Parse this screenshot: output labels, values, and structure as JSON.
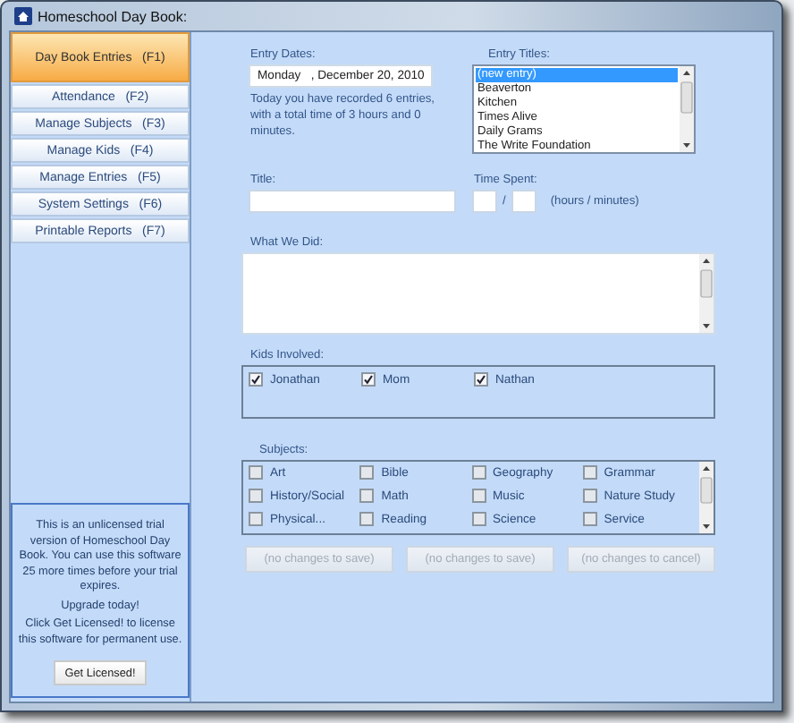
{
  "window": {
    "title": "Homeschool Day Book:"
  },
  "sidebar": {
    "items": [
      {
        "label": "Day Book Entries   (F1)",
        "selected": true
      },
      {
        "label": "Attendance   (F2)",
        "selected": false
      },
      {
        "label": "Manage Subjects   (F3)",
        "selected": false
      },
      {
        "label": "Manage Kids   (F4)",
        "selected": false
      },
      {
        "label": "Manage Entries   (F5)",
        "selected": false
      },
      {
        "label": "System Settings   (F6)",
        "selected": false
      },
      {
        "label": "Printable Reports   (F7)",
        "selected": false
      }
    ],
    "trial_notice": {
      "paragraphs": [
        "This is an unlicensed trial version of Homeschool Day Book.  You can use this software 25 more times before your trial expires.",
        "Upgrade today!",
        "Click Get Licensed! to license this software for permanent use."
      ],
      "button": "Get Licensed!"
    }
  },
  "entry_dates": {
    "label": "Entry Dates:",
    "value": "Monday   , December 20, 2010",
    "summary": "Today you have recorded 6 entries, with a total time of 3 hours and 0 minutes."
  },
  "entry_titles": {
    "label": "Entry Titles:",
    "items": [
      {
        "label": "(new entry)",
        "selected": true
      },
      {
        "label": "Beaverton",
        "selected": false
      },
      {
        "label": "Kitchen",
        "selected": false
      },
      {
        "label": "Times Alive",
        "selected": false
      },
      {
        "label": "Daily Grams",
        "selected": false
      },
      {
        "label": "The Write Foundation",
        "selected": false
      }
    ]
  },
  "title": {
    "label": "Title:"
  },
  "time_spent": {
    "label": "Time Spent:",
    "separator": "/",
    "hint": "(hours / minutes)"
  },
  "what_we_did": {
    "label": "What We Did:"
  },
  "kids": {
    "label": "Kids Involved:",
    "items": [
      {
        "label": "Jonathan",
        "checked": true
      },
      {
        "label": "Mom",
        "checked": true
      },
      {
        "label": "Nathan",
        "checked": true
      }
    ]
  },
  "subjects": {
    "label": "Subjects:",
    "items": [
      {
        "label": "Art",
        "checked": false
      },
      {
        "label": "Bible",
        "checked": false
      },
      {
        "label": "Geography",
        "checked": false
      },
      {
        "label": "Grammar",
        "checked": false
      },
      {
        "label": "History/Social",
        "checked": false
      },
      {
        "label": "Math",
        "checked": false
      },
      {
        "label": "Music",
        "checked": false
      },
      {
        "label": "Nature Study",
        "checked": false
      },
      {
        "label": "Physical...",
        "checked": false
      },
      {
        "label": "Reading",
        "checked": false
      },
      {
        "label": "Science",
        "checked": false
      },
      {
        "label": "Service",
        "checked": false
      }
    ]
  },
  "buttons": [
    {
      "label": "(no changes to save)",
      "disabled": true
    },
    {
      "label": "(no changes to save)",
      "disabled": true
    },
    {
      "label": "(no changes to cancel)",
      "disabled": true
    }
  ]
}
